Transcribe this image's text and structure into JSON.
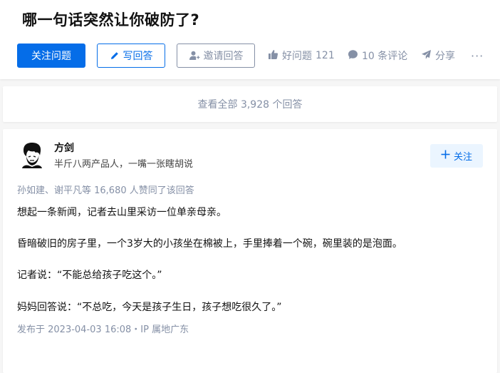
{
  "question": {
    "title": "哪一句话突然让你破防了?"
  },
  "actions": {
    "follow_label": "关注问题",
    "write_label": "写回答",
    "invite_label": "邀请回答",
    "like_label": "好问题",
    "like_count": "121",
    "comment_label": "10 条评论",
    "share_label": "分享",
    "more_label": "···"
  },
  "view_all": {
    "label": "查看全部 3,928 个回答"
  },
  "answer": {
    "author_name": "方剑",
    "author_bio": "半斤八两产品人，一嘴一张瞎胡说",
    "follow_label": "关注",
    "voters_text": "孙如建、谢平凡等 16,680 人赞同了该回答",
    "paragraphs": [
      "想起一条新闻，记者去山里采访一位单亲母亲。",
      "昏暗破旧的房子里，一个3岁大的小孩坐在棉被上，手里捧着一个碗，碗里装的是泡面。",
      "记者说：“不能总给孩子吃这个。”",
      "妈妈回答说：“不总吃，今天是孩子生日，孩子想吃很久了。”"
    ],
    "publish_info": "发布于 2023-04-03 16:08・IP 属地广东"
  },
  "colors": {
    "brand_blue": "#056de8",
    "muted_gray": "#8590a6",
    "page_bg": "#f6f6f6",
    "follow_bg": "#ebf5ff"
  },
  "icons": {
    "write": "pen-icon",
    "invite": "add-user-icon",
    "like": "thumbs-up-icon",
    "comment": "comment-bubble-icon",
    "share": "paper-plane-icon",
    "follow": "plus-icon"
  }
}
